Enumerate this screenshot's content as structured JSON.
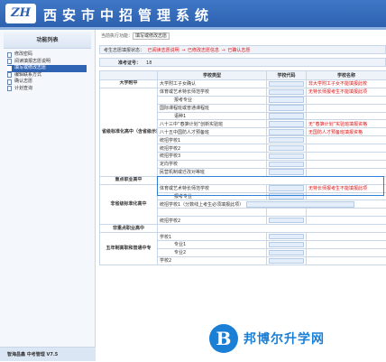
{
  "header": {
    "logo_text": "ZH",
    "site_title": "西安市中招管理系统"
  },
  "sidebar": {
    "title": "功能列表",
    "items": [
      {
        "label": "修改密码",
        "active": false
      },
      {
        "label": "阅读填报志愿说明",
        "active": false
      },
      {
        "label": "填写或修改志愿",
        "active": true
      },
      {
        "label": "编辑联系方式",
        "active": false
      },
      {
        "label": "确认志愿",
        "active": false
      },
      {
        "label": "计划查询",
        "active": false
      }
    ],
    "footer": "智海昌鑫 中考管理 V7.5"
  },
  "main": {
    "crumb_prefix": "当前执行功能：",
    "crumb_current": "填写或修改志愿",
    "steps_label": "考生志愿填报状态：",
    "steps": [
      "已阅读志愿说明",
      "已修改志愿信息",
      "已确认志愿"
    ],
    "exam_label": "准考证号：",
    "exam_value": "18",
    "table": {
      "headers": [
        "学校类型",
        "学校代码",
        "学校名称"
      ],
      "rows": [
        {
          "cat": "大学附中",
          "sch": "大学附工子女确认",
          "name": "非大学附工子女不能填报此校"
        },
        {
          "cat": "",
          "sch": "体育或艺术特长师范学校",
          "name": "无特长师报考生不能填报此项"
        },
        {
          "cat": "",
          "sch": "报考专业",
          "name": ""
        },
        {
          "cat": "",
          "sch": "国际课程班或普通课程班",
          "name": ""
        },
        {
          "cat": "",
          "sch": "语种1",
          "name": ""
        },
        {
          "cat": "",
          "sch": "八十三中“春笋计划”创新实验班",
          "name": "无“春笋计划”实验班填报资格"
        },
        {
          "cat": "",
          "sch": "八十五中国防人才预备班",
          "name": "无国防人才预备班填报资格"
        },
        {
          "cat": "",
          "sch": "统招学校1",
          "name": ""
        },
        {
          "cat": "",
          "sch": "统招学校2",
          "name": ""
        },
        {
          "cat": "",
          "sch": "统招学校3",
          "name": ""
        },
        {
          "cat": "",
          "sch": "定向学校",
          "name": ""
        },
        {
          "cat": "",
          "sch": "民营机制或迁改对等班",
          "name": ""
        },
        {
          "cat": "重点职业高中",
          "sch": "",
          "name": ""
        },
        {
          "cat": "",
          "sch": "体育或艺术特长师范学校",
          "name": "无特长师报考生不能填报此项"
        },
        {
          "cat": "",
          "sch": "报考专业",
          "name": ""
        },
        {
          "cat": "",
          "sch": "统招学校1（分数线上考生必须填报此项）",
          "name": ""
        },
        {
          "cat": "",
          "sch": "",
          "name": ""
        },
        {
          "cat": "",
          "sch": "统招学校2",
          "name": ""
        },
        {
          "cat": "非重点职业高中",
          "sch": "",
          "name": ""
        },
        {
          "cat": "",
          "sch": "学校1",
          "name": ""
        },
        {
          "cat": "",
          "sch": "专业1",
          "name": ""
        },
        {
          "cat": "",
          "sch": "专业2",
          "name": ""
        },
        {
          "cat": "",
          "sch": "学校2",
          "name": ""
        }
      ],
      "cat_labels": {
        "demo": "省级标准化高中（含省级示范高中）",
        "nondemo": "非省级标准化高中",
        "five": "五年制高职和普通中专"
      }
    }
  },
  "watermark": {
    "mark": "B",
    "text": "邦博尔升学网"
  },
  "colors": {
    "accent": "#2f63b4",
    "warning": "#dd1111",
    "panel": "#eef3fa"
  }
}
